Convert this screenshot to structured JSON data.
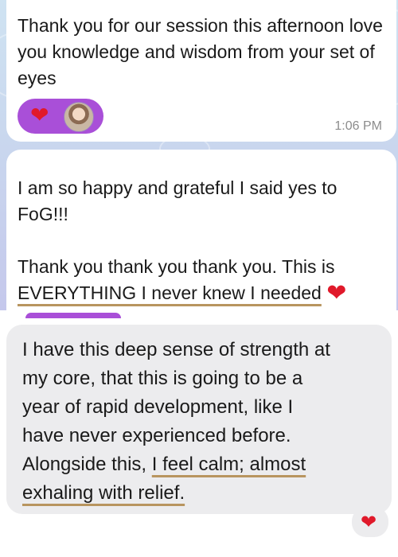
{
  "message1": {
    "text": "Thank you for our session this afternoon love you knowledge and wisdom from your set of eyes",
    "reaction_emoji": "❤",
    "time": "1:06 PM"
  },
  "message2": {
    "line1": "I am so happy and grateful I said yes to",
    "line2": "FoG!!!",
    "line3": "Thank you thank you thank you. This is",
    "line4_underlined": "EVERYTHING I never knew I needed",
    "line4_emoji": "❤"
  },
  "message3": {
    "line1": "I have this deep sense of strength at",
    "line2": "my core, that this is going to be a",
    "line3": "year of rapid development, like I",
    "line4": "have never experienced before.",
    "line5_plain": "Alongside this, ",
    "line5_underlined": "I feel calm; almost",
    "line6_underlined": "exhaling with relief.",
    "reaction_emoji": "❤"
  },
  "colors": {
    "reaction_pill": "#a94fd8",
    "heart": "#e0192a",
    "underline": "#b8955f",
    "incoming_bubble": "#ececee"
  }
}
